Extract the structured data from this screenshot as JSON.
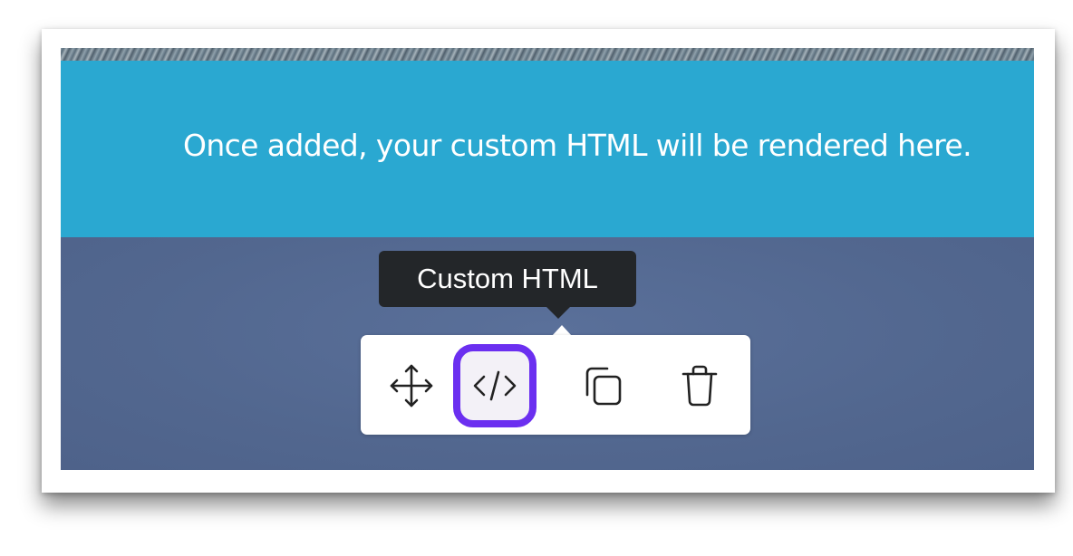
{
  "editor": {
    "block_placeholder": "Once added, your custom HTML will be rendered here.",
    "tooltip": "Custom HTML",
    "toolbar": {
      "items": [
        {
          "name": "move",
          "icon": "move-arrows-icon"
        },
        {
          "name": "custom-html",
          "icon": "code-icon",
          "active": true
        },
        {
          "name": "duplicate",
          "icon": "duplicate-icon"
        },
        {
          "name": "delete",
          "icon": "trash-icon"
        }
      ]
    }
  },
  "colors": {
    "block_background": "#2aa8d1",
    "page_background": "#546a91",
    "tooltip_background": "#232629",
    "active_outline": "#6b2ff0"
  }
}
